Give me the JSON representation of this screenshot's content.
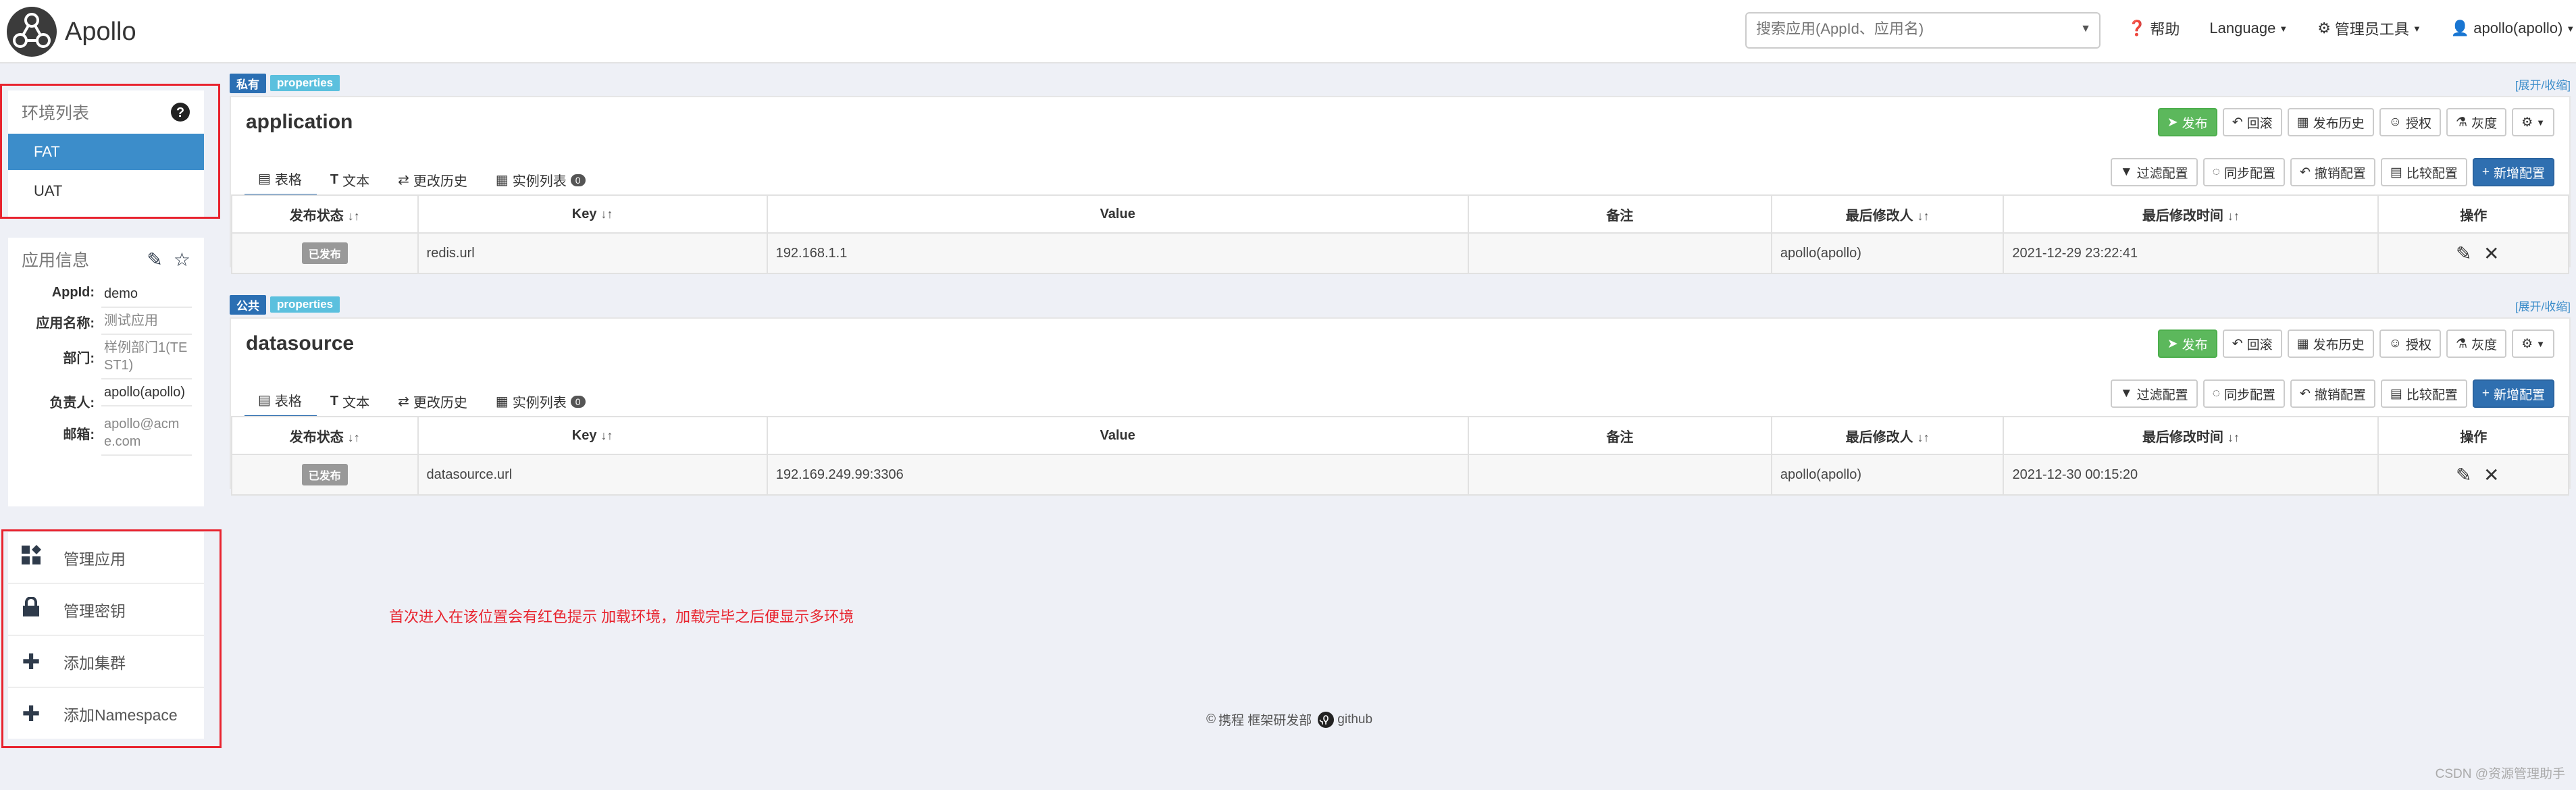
{
  "header": {
    "logo_text": "Apollo",
    "search_placeholder": "搜索应用(AppId、应用名)",
    "nav": {
      "help": "帮助",
      "language": "Language",
      "admin_tools": "管理员工具",
      "user": "apollo(apollo)"
    }
  },
  "env_panel": {
    "title": "环境列表",
    "items": [
      "FAT",
      "UAT"
    ],
    "active": "FAT"
  },
  "app_info": {
    "title": "应用信息",
    "fields": [
      {
        "key": "AppId:",
        "value": "demo"
      },
      {
        "key": "应用名称:",
        "value": "测试应用"
      },
      {
        "key": "部门:",
        "value": "样例部门1(TEST1)"
      },
      {
        "key": "负责人:",
        "value": "apollo(apollo)"
      },
      {
        "key": "邮箱:",
        "value": "apollo@acme.com"
      }
    ]
  },
  "actions": [
    {
      "label": "管理应用",
      "icon": "grid-icon"
    },
    {
      "label": "管理密钥",
      "icon": "lock-icon"
    },
    {
      "label": "添加集群",
      "icon": "plus-icon"
    },
    {
      "label": "添加Namespace",
      "icon": "plus-icon"
    }
  ],
  "buttons": {
    "release": "发布",
    "rollback": "回滚",
    "release_history": "发布历史",
    "authorize": "授权",
    "gray": "灰度",
    "filter": "过滤配置",
    "sync": "同步配置",
    "revoke": "撤销配置",
    "compare": "比较配置",
    "add": "新增配置"
  },
  "tabs": {
    "table": "表格",
    "text": "文本",
    "history": "更改历史",
    "instances": "实例列表",
    "instances_count": "0"
  },
  "columns": {
    "status": "发布状态",
    "key": "Key",
    "value": "Value",
    "comment": "备注",
    "modifier": "最后修改人",
    "modified_time": "最后修改时间",
    "ops": "操作"
  },
  "expand_link": "[展开/收缩]",
  "namespaces": [
    {
      "scope": "私有",
      "format": "properties",
      "name": "application",
      "rows": [
        {
          "status": "已发布",
          "key": "redis.url",
          "value": "192.168.1.1",
          "comment": "",
          "modifier": "apollo(apollo)",
          "time": "2021-12-29 23:22:41"
        }
      ]
    },
    {
      "scope": "公共",
      "format": "properties",
      "name": "datasource",
      "rows": [
        {
          "status": "已发布",
          "key": "datasource.url",
          "value": "192.169.249.99:3306",
          "comment": "",
          "modifier": "apollo(apollo)",
          "time": "2021-12-30 00:15:20"
        }
      ]
    }
  ],
  "hint": "首次进入在该位置会有红色提示 加载环境，加载完毕之后便显示多环境",
  "footer": {
    "company": "携程 框架研发部",
    "github": "github"
  },
  "watermark": "CSDN @资源管理助手"
}
